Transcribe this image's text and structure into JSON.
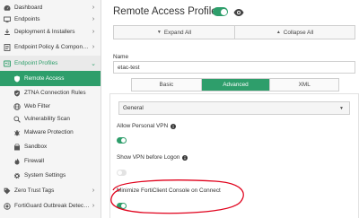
{
  "sidebar": {
    "items": [
      {
        "label": "Dashboard",
        "icon": "dashboard-icon",
        "chevron": true
      },
      {
        "label": "Endpoints",
        "icon": "endpoints-icon",
        "chevron": true
      },
      {
        "label": "Deployment & Installers",
        "icon": "deployment-icon",
        "chevron": true
      },
      {
        "label": "Endpoint Policy & Compone...",
        "icon": "policy-icon",
        "chevron": true
      },
      {
        "label": "Endpoint Profiles",
        "icon": "profiles-icon",
        "chevron": true,
        "state": "expanded"
      },
      {
        "label": "Remote Access",
        "icon": "shield-icon",
        "sub": true,
        "state": "active"
      },
      {
        "label": "ZTNA Connection Rules",
        "icon": "ztna-icon",
        "sub": true
      },
      {
        "label": "Web Filter",
        "icon": "globe-icon",
        "sub": true
      },
      {
        "label": "Vulnerability Scan",
        "icon": "scan-icon",
        "sub": true
      },
      {
        "label": "Malware Protection",
        "icon": "malware-icon",
        "sub": true
      },
      {
        "label": "Sandbox",
        "icon": "sandbox-icon",
        "sub": true
      },
      {
        "label": "Firewall",
        "icon": "firewall-icon",
        "sub": true
      },
      {
        "label": "System Settings",
        "icon": "gear-icon",
        "sub": true
      },
      {
        "label": "Zero Trust Tags",
        "icon": "tag-icon",
        "chevron": true
      },
      {
        "label": "FortiGuard Outbreak Detect...",
        "icon": "outbreak-icon",
        "chevron": true
      }
    ]
  },
  "header": {
    "title": "Remote Access Profile",
    "enabled": true,
    "view_icon": "eye-icon"
  },
  "toolbar": {
    "expand_label": "Expand All",
    "collapse_label": "Collapse All"
  },
  "form": {
    "name_label": "Name",
    "name_value": "etac-test",
    "tabs": [
      "Basic",
      "Advanced",
      "XML"
    ],
    "active_tab": "Advanced"
  },
  "general": {
    "title": "General",
    "settings": [
      {
        "label": "Allow Personal VPN",
        "info": true,
        "enabled": true
      },
      {
        "label": "Show VPN before Logon",
        "info": true,
        "enabled": false
      },
      {
        "label": "Minimize FortiClient Console on Connect",
        "info": false,
        "enabled": true
      }
    ]
  },
  "colors": {
    "accent": "#2e9e6b",
    "annotation": "#e0001b"
  }
}
